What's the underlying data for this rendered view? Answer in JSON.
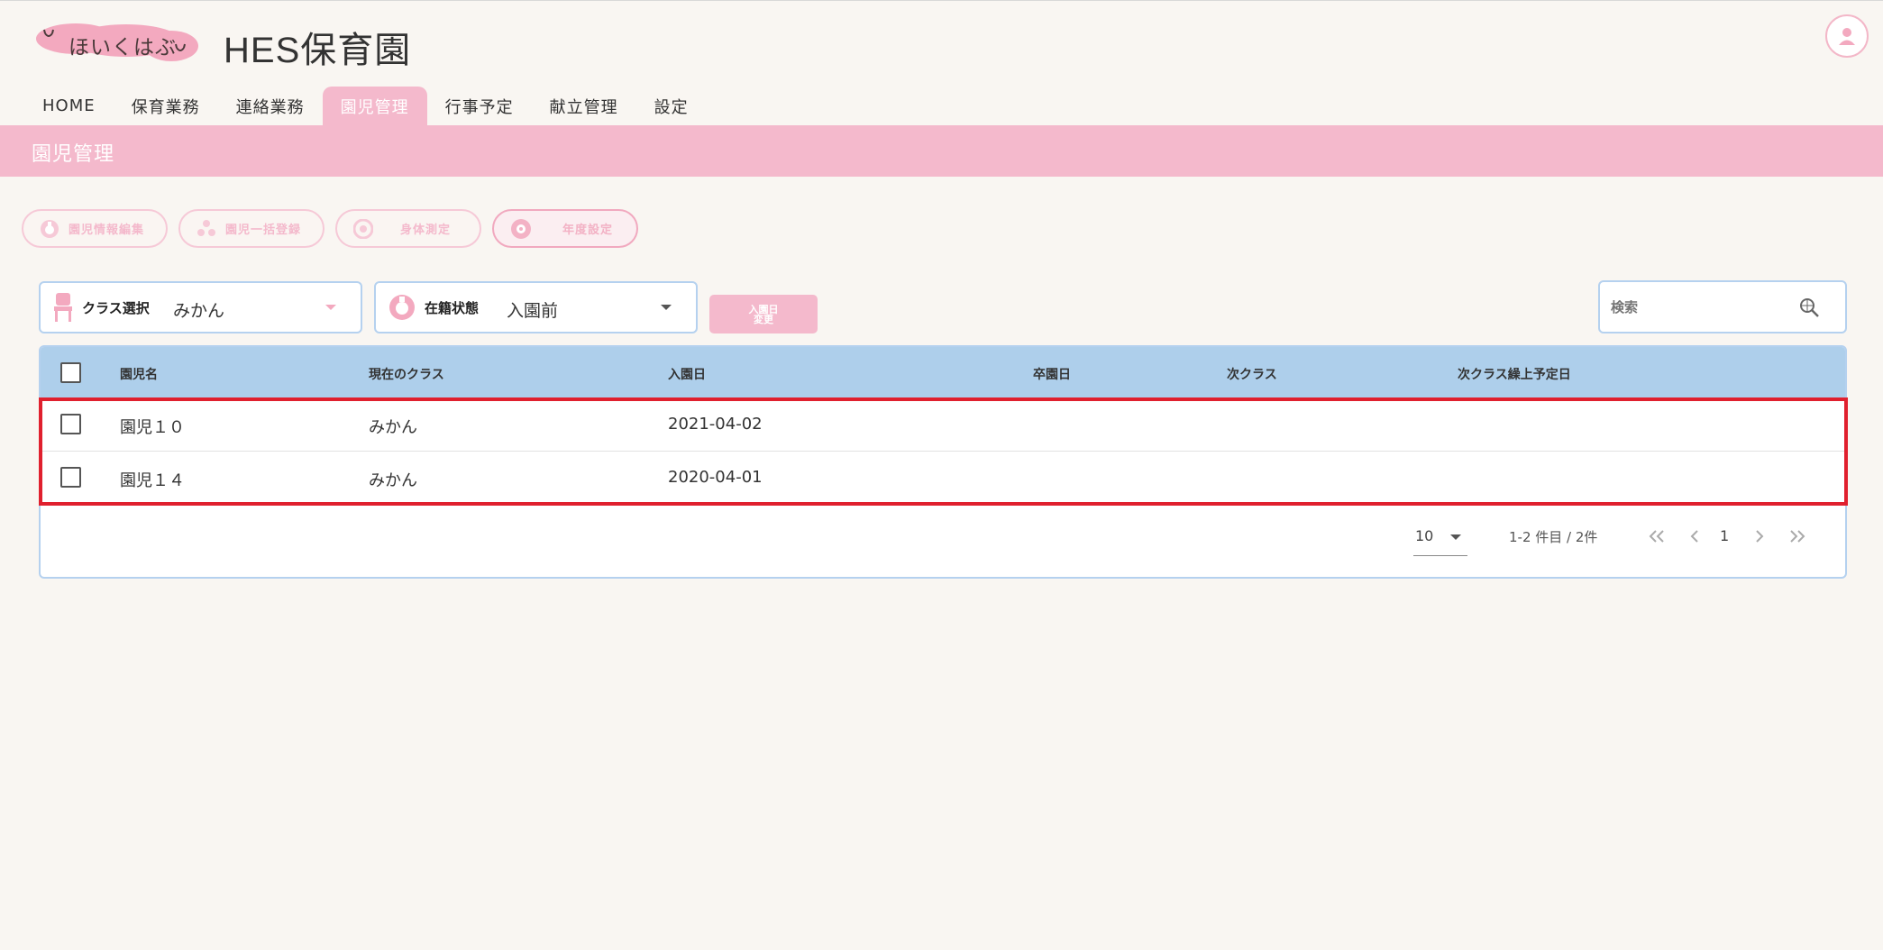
{
  "header": {
    "logo_text": "ほいくはぶ",
    "app_title": "HES保育園"
  },
  "nav": {
    "tabs": [
      {
        "label": "HOME",
        "active": false
      },
      {
        "label": "保育業務",
        "active": false
      },
      {
        "label": "連絡業務",
        "active": false
      },
      {
        "label": "園児管理",
        "active": true
      },
      {
        "label": "行事予定",
        "active": false
      },
      {
        "label": "献立管理",
        "active": false
      },
      {
        "label": "設定",
        "active": false
      }
    ]
  },
  "section": {
    "title": "園児管理"
  },
  "actions": [
    {
      "label": "園児情報編集",
      "icon": "child-face-icon"
    },
    {
      "label": "園児一括登録",
      "icon": "group-icon"
    },
    {
      "label": "身体測定",
      "icon": "measure-icon"
    },
    {
      "label": "年度設定",
      "icon": "gear-face-icon"
    }
  ],
  "filters": {
    "class_label": "クラス選択",
    "class_value": "みかん",
    "status_label": "在籍状態",
    "status_value": "入園前",
    "date_button_line1": "入園日",
    "date_button_line2": "変更",
    "search_placeholder": "検索"
  },
  "table": {
    "columns": [
      "園児名",
      "現在のクラス",
      "入園日",
      "卒園日",
      "次クラス",
      "次クラス繰上予定日"
    ],
    "rows": [
      {
        "name": "園児１０",
        "class": "みかん",
        "entry_date": "2021-04-02",
        "grad_date": "",
        "next_class": "",
        "next_date": ""
      },
      {
        "name": "園児１４",
        "class": "みかん",
        "entry_date": "2020-04-01",
        "grad_date": "",
        "next_class": "",
        "next_date": ""
      }
    ]
  },
  "pagination": {
    "per_page": "10",
    "range": "1-2 件目 / 2件",
    "current_page": "1"
  },
  "colors": {
    "accent_pink": "#f4b9cc",
    "table_header_blue": "#aecfeb",
    "highlight_red": "#e0202e"
  }
}
